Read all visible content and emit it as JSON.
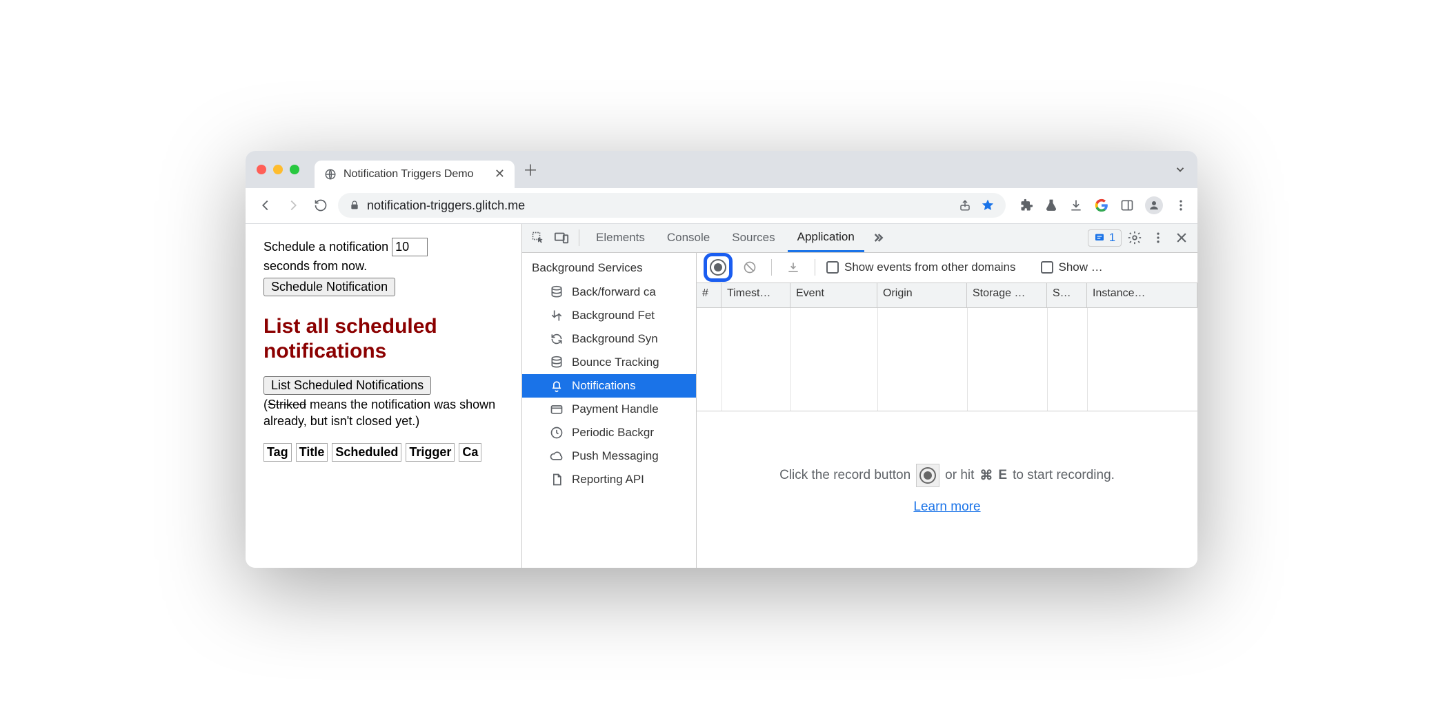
{
  "tab": {
    "title": "Notification Triggers Demo"
  },
  "omnibox": {
    "url": "notification-triggers.glitch.me"
  },
  "page": {
    "schedule_prefix": "Schedule a notification",
    "seconds_value": "10",
    "schedule_suffix": "seconds from now.",
    "schedule_button": "Schedule Notification",
    "heading": "List all scheduled notifications",
    "list_button": "List Scheduled Notifications",
    "note_paren_open": "(",
    "note_striked": "Striked",
    "note_rest": " means the notification was shown already, but isn't closed yet.)",
    "cols": [
      "Tag",
      "Title",
      "Scheduled",
      "Trigger",
      "Ca"
    ]
  },
  "devtools": {
    "tabs": [
      "Elements",
      "Console",
      "Sources",
      "Application"
    ],
    "active_tab": "Application",
    "issue_count": "1",
    "sidebar_heading": "Background Services",
    "sidebar_items": [
      {
        "icon": "db",
        "label": "Back/forward ca"
      },
      {
        "icon": "fetch",
        "label": "Background Fet"
      },
      {
        "icon": "sync",
        "label": "Background Syn"
      },
      {
        "icon": "db",
        "label": "Bounce Tracking"
      },
      {
        "icon": "bell",
        "label": "Notifications",
        "active": true
      },
      {
        "icon": "card",
        "label": "Payment Handle"
      },
      {
        "icon": "clock",
        "label": "Periodic Backgr"
      },
      {
        "icon": "cloud",
        "label": "Push Messaging"
      },
      {
        "icon": "doc",
        "label": "Reporting API"
      }
    ],
    "action_bar": {
      "checkbox1": "Show events from other domains",
      "checkbox2": "Show …"
    },
    "columns": [
      "#",
      "Timest…",
      "Event",
      "Origin",
      "Storage …",
      "S…",
      "Instance…"
    ],
    "empty_state": {
      "prefix": "Click the record button ",
      "mid": " or hit ",
      "shortcut_mod": "⌘",
      "shortcut_key": "E",
      "suffix": " to start recording.",
      "learn_more": "Learn more"
    }
  }
}
